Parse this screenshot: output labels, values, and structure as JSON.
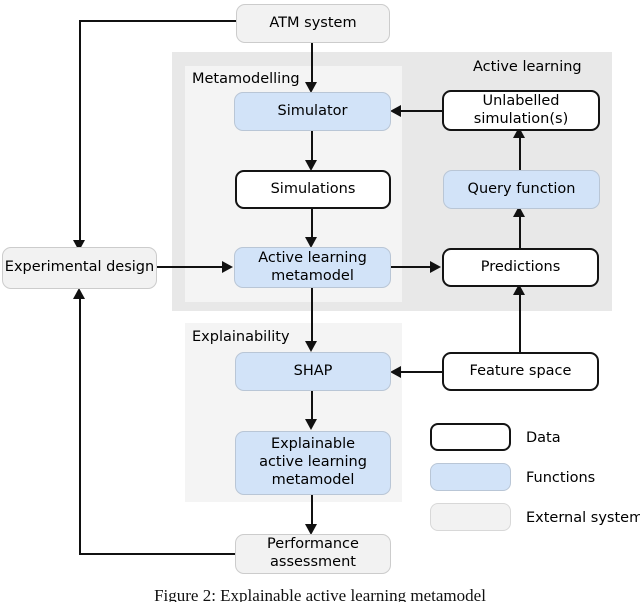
{
  "figure": {
    "caption": "Figure 2: Explainable active learning metamodel"
  },
  "regions": {
    "active_learning": {
      "label": "Active learning"
    },
    "metamodelling": {
      "label": "Metamodelling"
    },
    "explainability": {
      "label": "Explainability"
    }
  },
  "nodes": {
    "atm_system": {
      "label": "ATM system",
      "type": "external"
    },
    "experimental_design": {
      "label": "Experimental design",
      "type": "external"
    },
    "simulator": {
      "label": "Simulator",
      "type": "function"
    },
    "simulations": {
      "label": "Simulations",
      "type": "data"
    },
    "active_learning_metamodel": {
      "label": "Active learning metamodel",
      "type": "function"
    },
    "unlabelled_simulations": {
      "label": "Unlabelled simulation(s)",
      "type": "data"
    },
    "query_function": {
      "label": "Query function",
      "type": "function"
    },
    "predictions": {
      "label": "Predictions",
      "type": "data"
    },
    "feature_space": {
      "label": "Feature space",
      "type": "data"
    },
    "shap": {
      "label": "SHAP",
      "type": "function"
    },
    "explainable_alm": {
      "label": "Explainable active learning metamodel",
      "type": "function"
    },
    "performance_assessment": {
      "label": "Performance assessment",
      "type": "external"
    }
  },
  "legend": {
    "items": [
      {
        "label": "Data",
        "type": "data",
        "color": "#ffffff"
      },
      {
        "label": "Functions",
        "type": "function",
        "color": "#d2e3f8"
      },
      {
        "label": "External systems",
        "type": "external",
        "color": "#f2f2f2"
      }
    ]
  },
  "colors": {
    "data_fill": "#ffffff",
    "data_stroke": "#141414",
    "function_fill": "#d2e3f8",
    "external_fill": "#f2f2f2",
    "region_outer": "#e8e8e8",
    "region_inner": "#f4f4f4",
    "connector": "#111111"
  }
}
